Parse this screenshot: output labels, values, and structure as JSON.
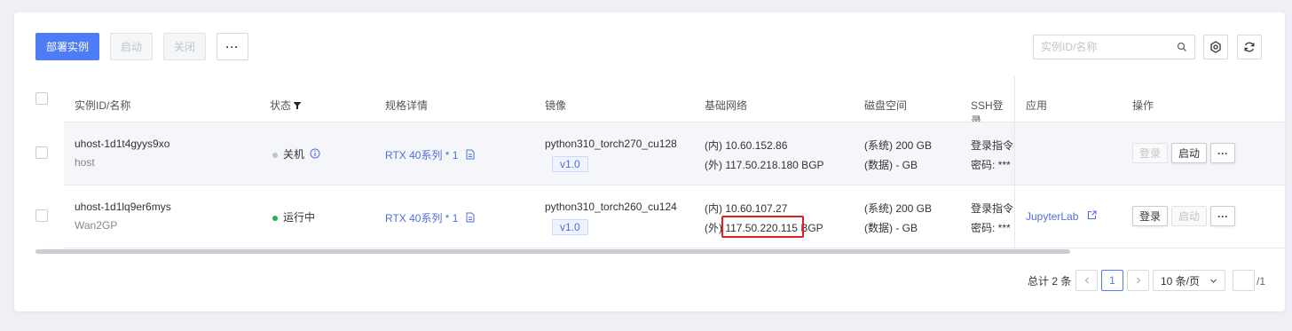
{
  "toolbar": {
    "deploy_label": "部署实例",
    "start_label": "启动",
    "shutdown_label": "关闭",
    "more_label": "···",
    "search_placeholder": "实例ID/名称"
  },
  "table": {
    "headers": {
      "instance": "实例ID/名称",
      "status": "状态",
      "spec": "规格详情",
      "image": "镜像",
      "network": "基础网络",
      "disk": "磁盘空间",
      "ssh": "SSH登录",
      "app": "应用",
      "actions": "操作"
    },
    "rows": [
      {
        "id": "uhost-1d1t4gyys9xo",
        "name": "host",
        "status": "关机",
        "status_color": "#c0c4cc",
        "spec": "RTX 40系列 * 1",
        "image": "python310_torch270_cu128",
        "image_version": "v1.0",
        "net_inner": "(内) 10.60.152.86",
        "net_outer": "(外) 117.50.218.180 BGP",
        "disk_system": "(系统) 200 GB",
        "disk_data": "(数据) - GB",
        "ssh_cmd": "登录指令:",
        "ssh_pwd": "密码: ***",
        "app": "",
        "btn_login": "登录",
        "btn_start": "启动",
        "btn_more": "···"
      },
      {
        "id": "uhost-1d1lq9er6mys",
        "name": "Wan2GP",
        "status": "运行中",
        "status_color": "#2bae4a",
        "spec": "RTX 40系列 * 1",
        "image": "python310_torch260_cu124",
        "image_version": "v1.0",
        "net_inner": "(内) 10.60.107.27",
        "net_outer_prefix": "(外)",
        "net_outer_ip": "117.50.220.115",
        "net_outer_suffix": "BGP",
        "disk_system": "(系统) 200 GB",
        "disk_data": "(数据) - GB",
        "ssh_cmd": "登录指令:",
        "ssh_pwd": "密码: ***",
        "app": "JupyterLab",
        "btn_login": "登录",
        "btn_start": "启动",
        "btn_more": "···"
      }
    ]
  },
  "pagination": {
    "total": "总计 2 条",
    "current_page": "1",
    "page_size": "10 条/页",
    "total_pages": "/1"
  },
  "colors": {
    "primary": "#4e7cf6",
    "link": "#4e6fdb",
    "highlight": "#e02020"
  }
}
